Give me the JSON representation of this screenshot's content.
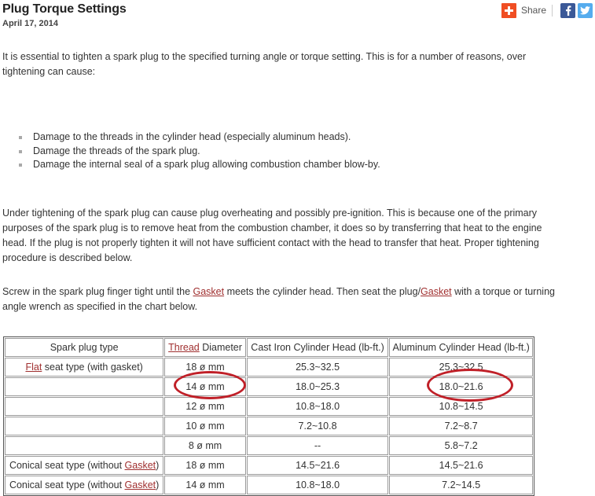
{
  "header": {
    "title": "Plug Torque Settings",
    "date": "April 17, 2014"
  },
  "share": {
    "plus_icon": "plus-icon",
    "label": "Share",
    "facebook_icon": "facebook-icon",
    "twitter_icon": "twitter-icon"
  },
  "article": {
    "intro_paragraph": "It is essential to tighten a spark plug to the specified turning angle or torque setting. This is for a number of reasons, over tightening can cause:",
    "bullets": [
      "Damage to the threads in the cylinder head (especially aluminum heads).",
      "Damage the threads of the spark plug.",
      "Damage the internal seal of a spark plug allowing combustion chamber blow-by."
    ],
    "under_paragraph": "Under tightening of the spark plug can cause plug overheating and possibly pre-ignition. This is because one of the primary purposes of the spark plug is to remove heat from the combustion chamber, it does so by transferring that heat to the engine head. If the plug is not properly tighten it will not have sufficient contact with the head to transfer that heat. Proper tightening procedure is described below.",
    "screw_paragraph": {
      "part1": "Screw in the spark plug finger tight until the ",
      "link1": "Gasket",
      "part2": " meets the cylinder head. Then seat the plug/",
      "link2": "Gasket",
      "part3": " with a torque or turning angle wrench as specified in the chart below."
    }
  },
  "table": {
    "headers": {
      "type": "Spark plug type",
      "diameter_link": "Thread",
      "diameter_rest": " Diameter",
      "cast_iron": "Cast Iron Cylinder Head (lb-ft.)",
      "aluminum": "Aluminum Cylinder Head (lb-ft.)"
    },
    "rows": [
      {
        "type_prefix": "",
        "type_link": "Flat",
        "type_suffix": " seat type (with gasket)",
        "diameter": "18 ø mm",
        "cast_iron": "25.3~32.5",
        "aluminum": "25.3~32.5"
      },
      {
        "type_prefix": "",
        "type_link": "",
        "type_suffix": "",
        "diameter": "14 ø mm",
        "cast_iron": "18.0~25.3",
        "aluminum": "18.0~21.6"
      },
      {
        "type_prefix": "",
        "type_link": "",
        "type_suffix": "",
        "diameter": "12 ø mm",
        "cast_iron": "10.8~18.0",
        "aluminum": "10.8~14.5"
      },
      {
        "type_prefix": "",
        "type_link": "",
        "type_suffix": "",
        "diameter": "10 ø mm",
        "cast_iron": "7.2~10.8",
        "aluminum": "7.2~8.7"
      },
      {
        "type_prefix": "",
        "type_link": "",
        "type_suffix": "",
        "diameter": "8 ø mm",
        "cast_iron": "--",
        "aluminum": "5.8~7.2"
      },
      {
        "type_prefix": "Conical seat type (without ",
        "type_link": "Gasket",
        "type_suffix": ")",
        "diameter": "18 ø mm",
        "cast_iron": "14.5~21.6",
        "aluminum": "14.5~21.6"
      },
      {
        "type_prefix": "Conical seat type (without ",
        "type_link": "Gasket",
        "type_suffix": ")",
        "diameter": "14 ø mm",
        "cast_iron": "10.8~18.0",
        "aluminum": "7.2~14.5"
      }
    ]
  },
  "annotations": [
    {
      "name": "highlight-diameter-14mm",
      "target": "14 ø mm",
      "color": "#c02028"
    },
    {
      "name": "highlight-aluminum-18-21.6",
      "target": "18.0~21.6",
      "color": "#c02028"
    }
  ],
  "colors": {
    "link": "#a03030",
    "annotation": "#c02028",
    "share_plus": "#f04e23",
    "facebook": "#3b5998",
    "twitter": "#55acee"
  }
}
